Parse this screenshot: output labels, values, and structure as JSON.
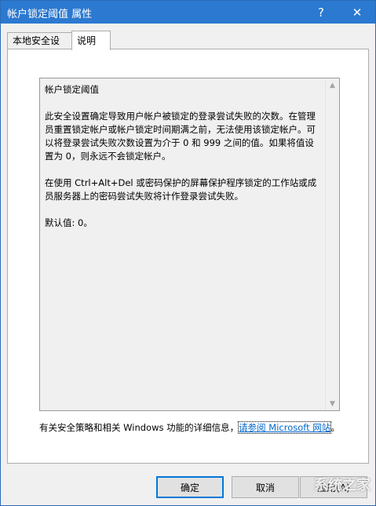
{
  "window": {
    "title": "帐户锁定阈值 属性",
    "help_label": "?",
    "close_label": "✕"
  },
  "tabs": [
    {
      "label": "本地安全设置"
    },
    {
      "label": "说明"
    }
  ],
  "description": {
    "heading": "帐户锁定阈值",
    "p1": "此安全设置确定导致用户帐户被锁定的登录尝试失败的次数。在管理员重置锁定帐户或帐户锁定时间期满之前，无法使用该锁定帐户。可以将登录尝试失败次数设置为介于 0 和 999 之间的值。如果将值设置为 0，则永远不会锁定帐户。",
    "p2": "在使用 Ctrl+Alt+Del 或密码保护的屏幕保护程序锁定的工作站或成员服务器上的密码尝试失败将计作登录尝试失败。",
    "p3": "默认值: 0。"
  },
  "footer": {
    "text": "有关安全策略和相关 Windows 功能的详细信息，",
    "link": "请参阅 Microsoft 网站",
    "suffix": "。"
  },
  "buttons": {
    "ok": "确定",
    "cancel": "取消",
    "apply": "应用(A)"
  },
  "watermark": "系统之家"
}
